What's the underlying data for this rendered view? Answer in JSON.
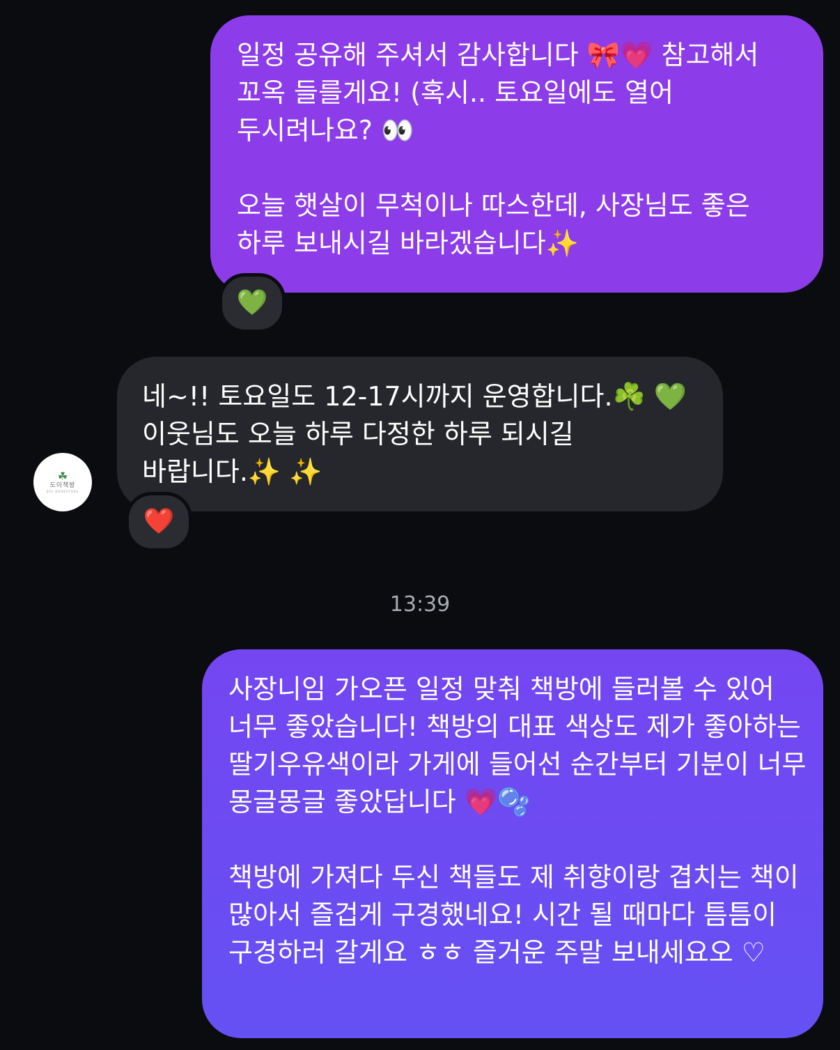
{
  "messages": [
    {
      "direction": "outgoing",
      "text": "일정 공유해 주셔서 감사합니다 🎀💗 참고해서 꼬옥 들를게요! (혹시.. 토요일에도 열어 두시려나요? 👀\n\n오늘 햇살이 무척이나 따스한데, 사장님도 좋은 하루 보내시길 바라겠습니다✨",
      "reaction": "💚"
    },
    {
      "direction": "incoming",
      "text": "네~!! 토요일도 12-17시까지 운영합니다.☘️ 💚\n이웃님도 오늘 하루 다정한 하루 되시길 바랍니다.✨ ✨",
      "reaction": "❤️",
      "avatar": {
        "logo_text": "도이책방",
        "logo_sub": "DOI BOOKSTORE"
      }
    },
    {
      "direction": "outgoing",
      "text": "사장니임 가오픈 일정 맞춰 책방에 들러볼 수 있어 너무 좋았습니다! 책방의 대표 색상도 제가 좋아하는 딸기우유색이라 가게에 들어선 순간부터 기분이 너무 몽글몽글 좋았답니다 💗🫧\n\n책방에 가져다 두신 책들도 제 취향이랑 겹치는 책이 많아서 즐겁게 구경했네요! 시간 될 때마다 틈틈이 구경하러 갈게요 ㅎㅎ 즐거운 주말 보내세요오 ♡"
    }
  ],
  "timestamp": "13:39",
  "colors": {
    "background": "#0b0c10",
    "outgoing_bubble_1": "#8d3cea",
    "outgoing_bubble_2": "#6a4cf2",
    "incoming_bubble": "#26272c",
    "reaction_pill": "#2b2c31",
    "timestamp_text": "#a9abb3"
  }
}
